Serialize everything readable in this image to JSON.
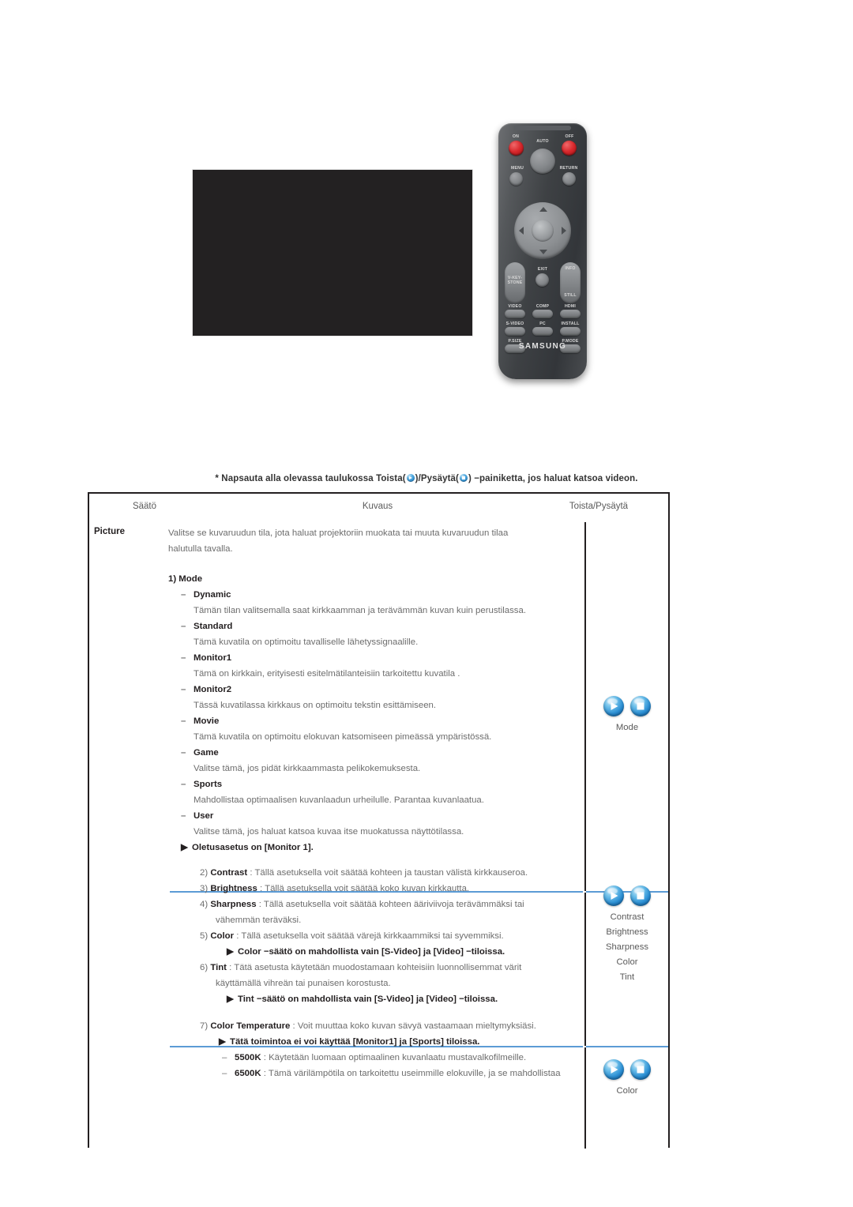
{
  "note": {
    "prefix": "* Napsauta alla olevassa taulukossa Toista(",
    "middle": ")/Pysäytä(",
    "suffix": ") −painiketta, jos haluat katsoa videon."
  },
  "remote": {
    "labels": {
      "on": "ON",
      "off": "OFF",
      "auto": "AUTO",
      "menu": "MENU",
      "return": "RETURN",
      "keystone": "V-KEY-\nSTONE",
      "exit": "EXIT",
      "info": "INFO",
      "still": "STILL",
      "video": "VIDEO",
      "comp": "COMP",
      "hdmi": "HDMI",
      "svideo": "S-VIDEO",
      "pc": "PC",
      "install": "INSTALL",
      "psize": "P.SIZE",
      "pmode": "P.MODE",
      "brand": "SAMSUNG"
    }
  },
  "table": {
    "headers": {
      "setting": "Säätö",
      "description": "Kuvaus",
      "playpause": "Toista/Pysäytä"
    },
    "sections": [
      {
        "label": "Picture",
        "intro": [
          "Valitse se kuvaruudun tila, jota haluat projektoriin muokata tai muuta kuvaruudun tilaa",
          "halutulla tavalla."
        ],
        "heading": "1) Mode",
        "items": [
          {
            "name": "Dynamic",
            "desc": "Tämän tilan valitsemalla saat kirkkaamman ja terävämmän kuvan kuin perustilassa."
          },
          {
            "name": "Standard",
            "desc": "Tämä kuvatila on optimoitu tavalliselle lähetyssignaalille."
          },
          {
            "name": "Monitor1",
            "desc": "Tämä on kirkkain, erityisesti esitelmätilanteisiin tarkoitettu kuvatila ."
          },
          {
            "name": "Monitor2",
            "desc": "Tässä kuvatilassa kirkkaus on optimoitu tekstin esittämiseen."
          },
          {
            "name": "Movie",
            "desc": "Tämä kuvatila on optimoitu elokuvan katsomiseen pimeässä ympäristössä."
          },
          {
            "name": "Game",
            "desc": "Valitse tämä, jos pidät kirkkaammasta pelikokemuksesta."
          },
          {
            "name": "Sports",
            "desc": "Mahdollistaa optimaalisen kuvanlaadun urheilulle. Parantaa kuvanlaatua."
          },
          {
            "name": "User",
            "desc": "Valitse tämä, jos haluat katsoa kuvaa itse muokatussa näyttötilassa."
          }
        ],
        "note": "Oletusasetus on [Monitor 1].",
        "media_captions": [
          "Mode"
        ]
      },
      {
        "numbered": [
          {
            "num": "2)",
            "name": "Contrast",
            "sep": " : ",
            "lines": [
              "Tällä asetuksella voit säätää kohteen ja taustan välistä kirkkauseroa."
            ]
          },
          {
            "num": "3)",
            "name": "Brightness",
            "sep": " : ",
            "lines": [
              "Tällä asetuksella voit säätää koko kuvan kirkkautta."
            ]
          },
          {
            "num": "4)",
            "name": "Sharpness",
            "sep": " : ",
            "lines": [
              "Tällä asetuksella voit säätää kohteen ääriviivoja terävämmäksi tai",
              "vähemmän teräväksi."
            ]
          },
          {
            "num": "5)",
            "name": "Color",
            "sep": " : ",
            "lines": [
              "Tällä asetuksella voit säätää värejä kirkkaammiksi tai syvemmiksi."
            ],
            "note": "Color −säätö on mahdollista vain [S-Video] ja [Video] −tiloissa."
          },
          {
            "num": "6)",
            "name": "Tint",
            "sep": " : ",
            "lines": [
              "Tätä asetusta käytetään muodostamaan kohteisiin luonnollisemmat värit",
              "käyttämällä vihreän tai punaisen korostusta."
            ],
            "note": "Tint −säätö on mahdollista vain [S-Video] ja [Video] −tiloissa."
          }
        ],
        "media_captions": [
          "Contrast",
          "Brightness",
          "Sharpness",
          "Color",
          "Tint"
        ]
      },
      {
        "numbered": [
          {
            "num": "7)",
            "name": "Color Temperature",
            "sep": " : ",
            "lines": [
              "Voit muuttaa koko kuvan sävyä vastaamaan mieltymyksiäsi."
            ],
            "note": "Tätä toimintoa ei voi käyttää [Monitor1] ja [Sports] tiloissa."
          }
        ],
        "kelvin": [
          {
            "name": "5500K",
            "sep": " : ",
            "desc": "Käytetään luomaan optimaalinen kuvanlaatu mustavalkofilmeille."
          },
          {
            "name": "6500K",
            "sep": " : ",
            "desc": "Tämä värilämpötila on tarkoitettu useimmille elokuville, ja se mahdollistaa"
          }
        ],
        "media_captions": [
          "Color"
        ]
      }
    ]
  },
  "colors": {
    "divider_blue": "#5b9bd5",
    "border_black": "#231f20",
    "sphere_blue": "#2b8fd4",
    "video_black": "#232122"
  }
}
